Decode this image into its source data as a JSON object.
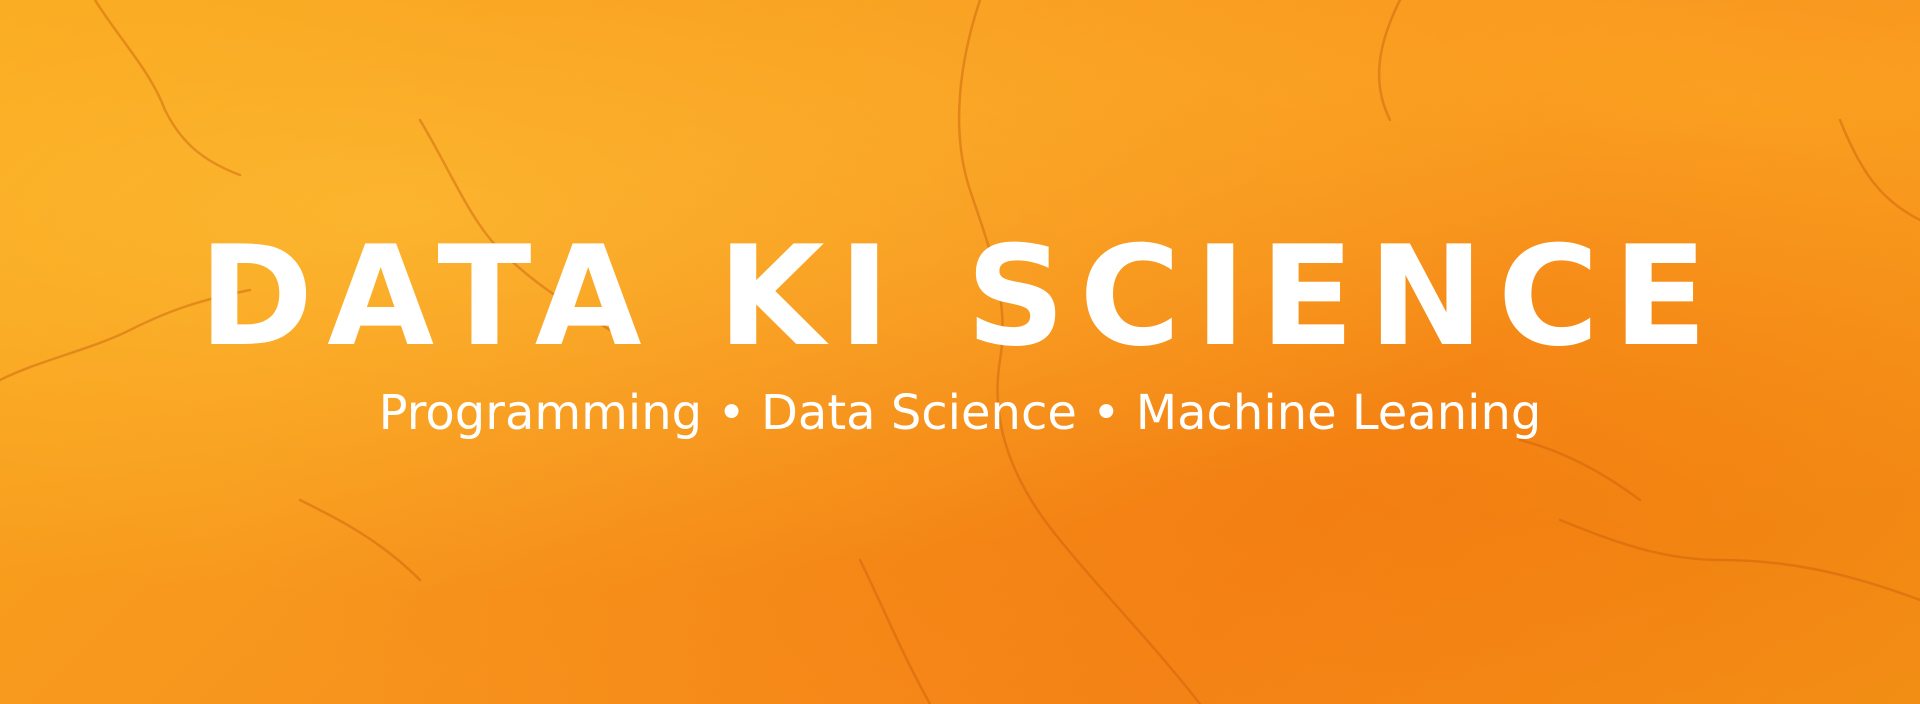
{
  "banner": {
    "title": "DATA KI SCIENCE",
    "subtitle": "Programming • Data Science • Machine Leaning",
    "background_color": "#f7941d",
    "text_color": "#ffffff"
  }
}
